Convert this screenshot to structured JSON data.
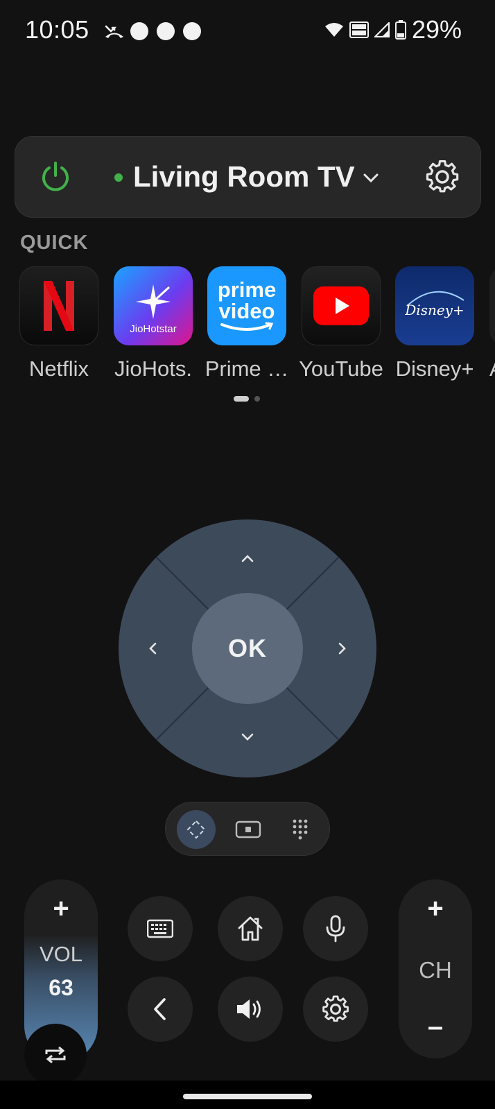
{
  "status_bar": {
    "time": "10:05",
    "battery": "29%",
    "icons": [
      "missed-call-icon",
      "notification-dot",
      "notification-dot",
      "notification-dot",
      "wifi-icon",
      "vowifi-icon",
      "signal-icon",
      "battery-icon"
    ]
  },
  "device": {
    "name": "Living Room TV",
    "status_color": "#43b14b",
    "power_color": "#43b14b"
  },
  "quick": {
    "label": "QUICK",
    "apps": [
      {
        "label": "Netflix",
        "icon": "netflix-logo"
      },
      {
        "label": "JioHots.",
        "icon": "jiohotstar-logo",
        "tile_text": "JioHotstar"
      },
      {
        "label": "Prime …",
        "icon": "prime-video-logo",
        "tile_text_1": "prime",
        "tile_text_2": "video"
      },
      {
        "label": "YouTube",
        "icon": "youtube-logo"
      },
      {
        "label": "Disney+",
        "icon": "disney-plus-logo",
        "tile_text": "Disney+"
      },
      {
        "label": "A",
        "icon": "app-icon"
      }
    ]
  },
  "dpad": {
    "ok_label": "OK",
    "color": "#3d4a5a",
    "ok_color": "#5c6a7c"
  },
  "modes": [
    "dpad-mode-icon",
    "touchpad-mode-icon",
    "numpad-mode-icon"
  ],
  "volume": {
    "plus": "+",
    "label": "VOL",
    "value": "63"
  },
  "channel": {
    "plus": "+",
    "label": "CH",
    "minus": "–"
  },
  "buttons": [
    "keyboard-icon",
    "home-icon",
    "microphone-icon",
    "back-icon",
    "sound-icon",
    "settings-icon"
  ]
}
